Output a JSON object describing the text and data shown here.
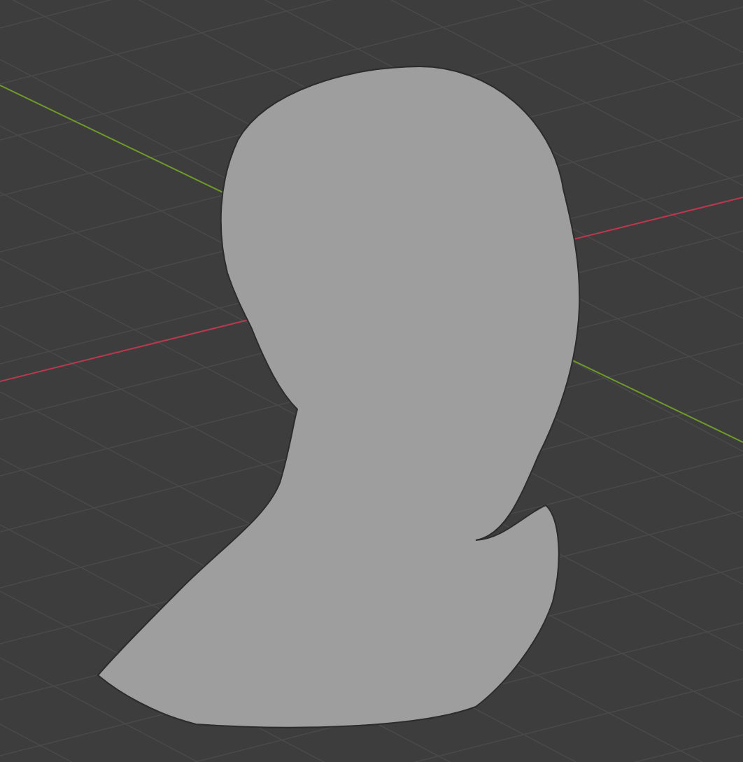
{
  "viewport": {
    "axes": [
      {
        "color": "#b8394f"
      },
      {
        "color": "#6f9a2a"
      }
    ]
  }
}
